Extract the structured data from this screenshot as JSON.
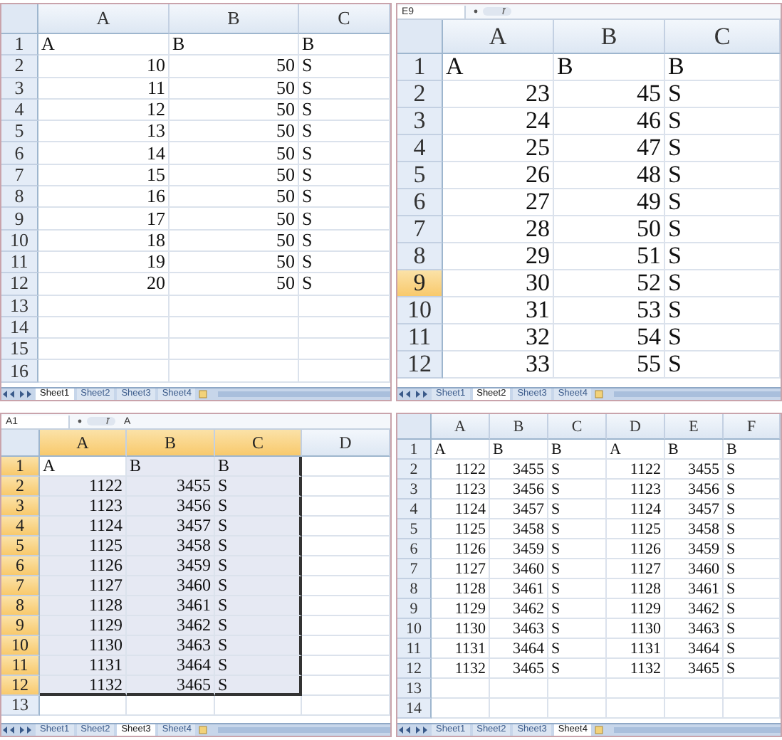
{
  "panels": [
    {
      "columns": [
        {
          "label": "A",
          "selected": false
        },
        {
          "label": "B",
          "selected": false
        },
        {
          "label": "C",
          "selected": false
        }
      ],
      "rows": [
        {
          "header": "1",
          "selected": false,
          "cells": [
            "A",
            "B",
            "B"
          ]
        },
        {
          "header": "2",
          "selected": false,
          "cells": [
            "10",
            "50",
            "S"
          ]
        },
        {
          "header": "3",
          "selected": false,
          "cells": [
            "11",
            "50",
            "S"
          ]
        },
        {
          "header": "4",
          "selected": false,
          "cells": [
            "12",
            "50",
            "S"
          ]
        },
        {
          "header": "5",
          "selected": false,
          "cells": [
            "13",
            "50",
            "S"
          ]
        },
        {
          "header": "6",
          "selected": false,
          "cells": [
            "14",
            "50",
            "S"
          ]
        },
        {
          "header": "7",
          "selected": false,
          "cells": [
            "15",
            "50",
            "S"
          ]
        },
        {
          "header": "8",
          "selected": false,
          "cells": [
            "16",
            "50",
            "S"
          ]
        },
        {
          "header": "9",
          "selected": false,
          "cells": [
            "17",
            "50",
            "S"
          ]
        },
        {
          "header": "10",
          "selected": false,
          "cells": [
            "18",
            "50",
            "S"
          ]
        },
        {
          "header": "11",
          "selected": false,
          "cells": [
            "19",
            "50",
            "S"
          ]
        },
        {
          "header": "12",
          "selected": false,
          "cells": [
            "20",
            "50",
            "S"
          ]
        },
        {
          "header": "13",
          "selected": false,
          "cells": []
        },
        {
          "header": "14",
          "selected": false,
          "cells": []
        },
        {
          "header": "15",
          "selected": false,
          "cells": []
        },
        {
          "header": "16",
          "selected": false,
          "cells": []
        }
      ],
      "sheet_tabs": [
        {
          "label": "Sheet1",
          "selected": true
        },
        {
          "label": "Sheet2",
          "selected": false
        },
        {
          "label": "Sheet3",
          "selected": false
        },
        {
          "label": "Sheet4",
          "selected": false
        }
      ]
    },
    {
      "name_box": "E9",
      "columns": [
        {
          "label": "A",
          "selected": false
        },
        {
          "label": "B",
          "selected": false
        },
        {
          "label": "C",
          "selected": false
        }
      ],
      "rows": [
        {
          "header": "1",
          "selected": false,
          "cells": [
            "A",
            "B",
            "B"
          ]
        },
        {
          "header": "2",
          "selected": false,
          "cells": [
            "23",
            "45",
            "S"
          ]
        },
        {
          "header": "3",
          "selected": false,
          "cells": [
            "24",
            "46",
            "S"
          ]
        },
        {
          "header": "4",
          "selected": false,
          "cells": [
            "25",
            "47",
            "S"
          ]
        },
        {
          "header": "5",
          "selected": false,
          "cells": [
            "26",
            "48",
            "S"
          ]
        },
        {
          "header": "6",
          "selected": false,
          "cells": [
            "27",
            "49",
            "S"
          ]
        },
        {
          "header": "7",
          "selected": false,
          "cells": [
            "28",
            "50",
            "S"
          ]
        },
        {
          "header": "8",
          "selected": false,
          "cells": [
            "29",
            "51",
            "S"
          ]
        },
        {
          "header": "9",
          "selected": true,
          "cells": [
            "30",
            "52",
            "S"
          ]
        },
        {
          "header": "10",
          "selected": false,
          "cells": [
            "31",
            "53",
            "S"
          ]
        },
        {
          "header": "11",
          "selected": false,
          "cells": [
            "32",
            "54",
            "S"
          ]
        },
        {
          "header": "12",
          "selected": false,
          "cells": [
            "33",
            "55",
            "S"
          ]
        }
      ],
      "sheet_tabs": [
        {
          "label": "Sheet1",
          "selected": false
        },
        {
          "label": "Sheet2",
          "selected": true
        },
        {
          "label": "Sheet3",
          "selected": false
        },
        {
          "label": "Sheet4",
          "selected": false
        }
      ]
    },
    {
      "name_box": "A1",
      "formula": "A",
      "columns": [
        {
          "label": "A",
          "selected": true
        },
        {
          "label": "B",
          "selected": true
        },
        {
          "label": "C",
          "selected": true
        },
        {
          "label": "D",
          "selected": false
        }
      ],
      "rows": [
        {
          "header": "1",
          "selected": true,
          "cells": [
            "A",
            "B",
            "B"
          ]
        },
        {
          "header": "2",
          "selected": true,
          "cells": [
            "1122",
            "3455",
            "S"
          ]
        },
        {
          "header": "3",
          "selected": true,
          "cells": [
            "1123",
            "3456",
            "S"
          ]
        },
        {
          "header": "4",
          "selected": true,
          "cells": [
            "1124",
            "3457",
            "S"
          ]
        },
        {
          "header": "5",
          "selected": true,
          "cells": [
            "1125",
            "3458",
            "S"
          ]
        },
        {
          "header": "6",
          "selected": true,
          "cells": [
            "1126",
            "3459",
            "S"
          ]
        },
        {
          "header": "7",
          "selected": true,
          "cells": [
            "1127",
            "3460",
            "S"
          ]
        },
        {
          "header": "8",
          "selected": true,
          "cells": [
            "1128",
            "3461",
            "S"
          ]
        },
        {
          "header": "9",
          "selected": true,
          "cells": [
            "1129",
            "3462",
            "S"
          ]
        },
        {
          "header": "10",
          "selected": true,
          "cells": [
            "1130",
            "3463",
            "S"
          ]
        },
        {
          "header": "11",
          "selected": true,
          "cells": [
            "1131",
            "3464",
            "S"
          ]
        },
        {
          "header": "12",
          "selected": true,
          "cells": [
            "1132",
            "3465",
            "S"
          ]
        },
        {
          "header": "13",
          "selected": false,
          "cells": []
        }
      ],
      "sheet_tabs": [
        {
          "label": "Sheet1",
          "selected": false
        },
        {
          "label": "Sheet2",
          "selected": false
        },
        {
          "label": "Sheet3",
          "selected": true
        },
        {
          "label": "Sheet4",
          "selected": false
        }
      ]
    },
    {
      "columns": [
        {
          "label": "A",
          "selected": false
        },
        {
          "label": "B",
          "selected": false
        },
        {
          "label": "C",
          "selected": false
        },
        {
          "label": "D",
          "selected": false
        },
        {
          "label": "E",
          "selected": false
        },
        {
          "label": "F",
          "selected": false
        }
      ],
      "rows": [
        {
          "header": "1",
          "selected": false,
          "cells": [
            "A",
            "B",
            "B",
            "A",
            "B",
            "B"
          ]
        },
        {
          "header": "2",
          "selected": false,
          "cells": [
            "1122",
            "3455",
            "S",
            "1122",
            "3455",
            "S"
          ]
        },
        {
          "header": "3",
          "selected": false,
          "cells": [
            "1123",
            "3456",
            "S",
            "1123",
            "3456",
            "S"
          ]
        },
        {
          "header": "4",
          "selected": false,
          "cells": [
            "1124",
            "3457",
            "S",
            "1124",
            "3457",
            "S"
          ]
        },
        {
          "header": "5",
          "selected": false,
          "cells": [
            "1125",
            "3458",
            "S",
            "1125",
            "3458",
            "S"
          ]
        },
        {
          "header": "6",
          "selected": false,
          "cells": [
            "1126",
            "3459",
            "S",
            "1126",
            "3459",
            "S"
          ]
        },
        {
          "header": "7",
          "selected": false,
          "cells": [
            "1127",
            "3460",
            "S",
            "1127",
            "3460",
            "S"
          ]
        },
        {
          "header": "8",
          "selected": false,
          "cells": [
            "1128",
            "3461",
            "S",
            "1128",
            "3461",
            "S"
          ]
        },
        {
          "header": "9",
          "selected": false,
          "cells": [
            "1129",
            "3462",
            "S",
            "1129",
            "3462",
            "S"
          ]
        },
        {
          "header": "10",
          "selected": false,
          "cells": [
            "1130",
            "3463",
            "S",
            "1130",
            "3463",
            "S"
          ]
        },
        {
          "header": "11",
          "selected": false,
          "cells": [
            "1131",
            "3464",
            "S",
            "1131",
            "3464",
            "S"
          ]
        },
        {
          "header": "12",
          "selected": false,
          "cells": [
            "1132",
            "3465",
            "S",
            "1132",
            "3465",
            "S"
          ]
        },
        {
          "header": "13",
          "selected": false,
          "cells": []
        },
        {
          "header": "14",
          "selected": false,
          "cells": []
        }
      ],
      "sheet_tabs": [
        {
          "label": "Sheet1",
          "selected": false
        },
        {
          "label": "Sheet2",
          "selected": false
        },
        {
          "label": "Sheet3",
          "selected": false
        },
        {
          "label": "Sheet4",
          "selected": true
        }
      ]
    }
  ]
}
